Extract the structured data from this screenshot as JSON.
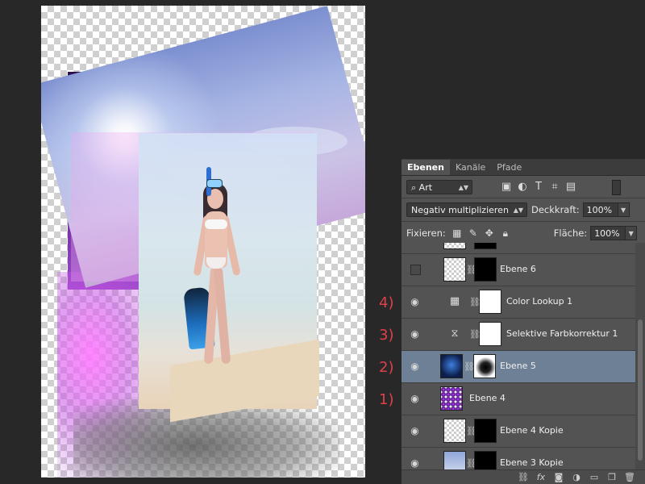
{
  "panel": {
    "tabs": [
      {
        "label": "Ebenen",
        "active": true
      },
      {
        "label": "Kanäle",
        "active": false
      },
      {
        "label": "Pfade",
        "active": false
      }
    ],
    "filter": {
      "kind": "Art",
      "icons": [
        "image-filter-icon",
        "adjustment-filter-icon",
        "type-filter-icon",
        "shape-filter-icon",
        "smartobject-filter-icon"
      ]
    },
    "blend_mode": "Negativ multiplizieren",
    "opacity_label": "Deckkraft:",
    "opacity_value": "100%",
    "lock_label": "Fixieren:",
    "fill_label": "Fläche:",
    "fill_value": "100%",
    "layers": [
      {
        "name": "Ebene 6",
        "visible": false,
        "selected": false,
        "annotation": ""
      },
      {
        "name": "Color Lookup 1",
        "visible": true,
        "selected": false,
        "annotation": "4)"
      },
      {
        "name": "Selektive Farbkorrektur 1",
        "visible": true,
        "selected": false,
        "annotation": "3)"
      },
      {
        "name": "Ebene 5",
        "visible": true,
        "selected": true,
        "annotation": "2)"
      },
      {
        "name": "Ebene 4",
        "visible": true,
        "selected": false,
        "annotation": "1)"
      },
      {
        "name": "Ebene 4 Kopie",
        "visible": true,
        "selected": false,
        "annotation": ""
      },
      {
        "name": "Ebene 3 Kopie",
        "visible": true,
        "selected": false,
        "annotation": ""
      }
    ],
    "colors": {
      "selected_row": "#6e8096",
      "panel_bg": "#535353",
      "annotation": "#e0404a"
    }
  }
}
